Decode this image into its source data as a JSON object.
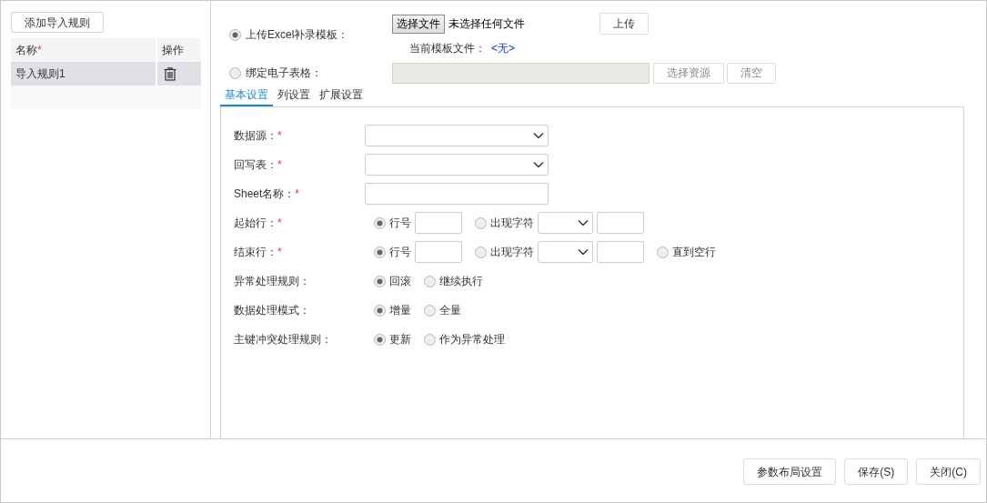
{
  "left_panel": {
    "add_button": "添加导入规则",
    "table": {
      "columns": [
        {
          "label": "名称",
          "required_mark": "*"
        },
        {
          "label": "操作"
        }
      ],
      "rows": [
        {
          "name": "导入规则1",
          "selected": true
        }
      ]
    }
  },
  "source": {
    "upload": {
      "label": "上传Excel补录模板：",
      "selected": true,
      "file_button": "选择文件",
      "file_status": "未选择任何文件",
      "upload_button": "上传",
      "current_label": "当前模板文件：",
      "current_value": "<无>"
    },
    "bind": {
      "label": "绑定电子表格：",
      "selected": false,
      "buttons": [
        "选择资源",
        "清空"
      ]
    }
  },
  "tabs": [
    {
      "label": "基本设置",
      "selected": true
    },
    {
      "label": "列设置",
      "selected": false
    },
    {
      "label": "扩展设置",
      "selected": false
    }
  ],
  "form": [
    {
      "label": "数据源：",
      "required_mark": "*",
      "controls": [
        {
          "kind": "select"
        }
      ]
    },
    {
      "label": "回写表：",
      "required_mark": "*",
      "controls": [
        {
          "kind": "select"
        }
      ]
    },
    {
      "label": "Sheet名称：",
      "required_mark": "*",
      "controls": [
        {
          "kind": "input"
        }
      ]
    },
    {
      "label": "起始行：",
      "required_mark": "*",
      "controls": [
        {
          "kind": "radio",
          "label": "行号",
          "selected": true
        },
        {
          "kind": "small-input"
        },
        {
          "kind": "radio",
          "label": "出现字符",
          "selected": false
        },
        {
          "kind": "small-select"
        },
        {
          "kind": "small-input"
        }
      ]
    },
    {
      "label": "结束行：",
      "required_mark": "*",
      "controls": [
        {
          "kind": "radio",
          "label": "行号",
          "selected": true
        },
        {
          "kind": "small-input"
        },
        {
          "kind": "radio",
          "label": "出现字符",
          "selected": false
        },
        {
          "kind": "small-select"
        },
        {
          "kind": "small-input"
        },
        {
          "kind": "radio",
          "label": "直到空行",
          "selected": false
        }
      ]
    },
    {
      "label": "异常处理规则：",
      "controls": [
        {
          "kind": "radio",
          "label": "回滚",
          "selected": true
        },
        {
          "kind": "radio",
          "label": "继续执行",
          "selected": false
        }
      ]
    },
    {
      "label": "数据处理模式：",
      "controls": [
        {
          "kind": "radio",
          "label": "增量",
          "selected": true
        },
        {
          "kind": "radio",
          "label": "全量",
          "selected": false
        }
      ]
    },
    {
      "label": "主键冲突处理规则：",
      "controls": [
        {
          "kind": "radio",
          "label": "更新",
          "selected": true
        },
        {
          "kind": "radio",
          "label": "作为异常处理",
          "selected": false
        }
      ]
    }
  ],
  "footer_buttons": [
    "参数布局设置",
    "保存(S)",
    "关闭(C)"
  ]
}
